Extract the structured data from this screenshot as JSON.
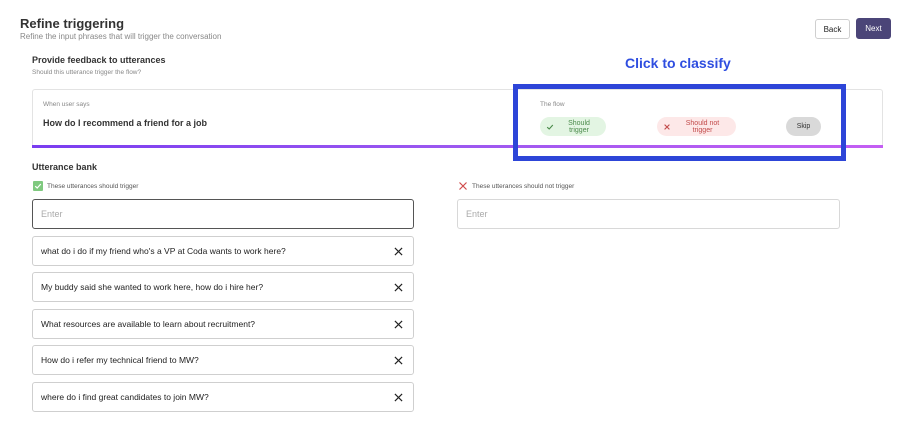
{
  "header": {
    "title": "Refine triggering",
    "subtitle": "Refine the input phrases that will trigger the conversation",
    "back_label": "Back",
    "next_label": "Next"
  },
  "feedback": {
    "title": "Provide feedback to utterances",
    "subtitle": "Should this utterance trigger the flow?",
    "when_label": "When user says",
    "utterance": "How do I recommend a friend for a job",
    "flow_label": "The flow",
    "should_trigger_label": "Should trigger",
    "should_not_trigger_label": "Should not trigger",
    "skip_label": "Skip"
  },
  "overlay": {
    "text": "Click to classify",
    "color": "#2d45d8"
  },
  "bank": {
    "title": "Utterance bank",
    "positive_label": "These utterances should trigger",
    "negative_label": "These utterances should not trigger",
    "positive_placeholder": "Enter",
    "negative_placeholder": "Enter",
    "positive_items": [
      "what do i do if my friend who's a VP at Coda wants to work here?",
      "My buddy said she wanted to work here, how do i hire her?",
      "What resources are available to learn about recruitment?",
      "How do i refer my technical friend to MW?",
      "where do i find great candidates to join MW?"
    ]
  },
  "colors": {
    "accent": "#4b4578",
    "trigger_green": "#4a8a4a",
    "no_trigger_red": "#c24a4a",
    "gradient_start": "#7a3df0",
    "gradient_end": "#c45ef3"
  }
}
